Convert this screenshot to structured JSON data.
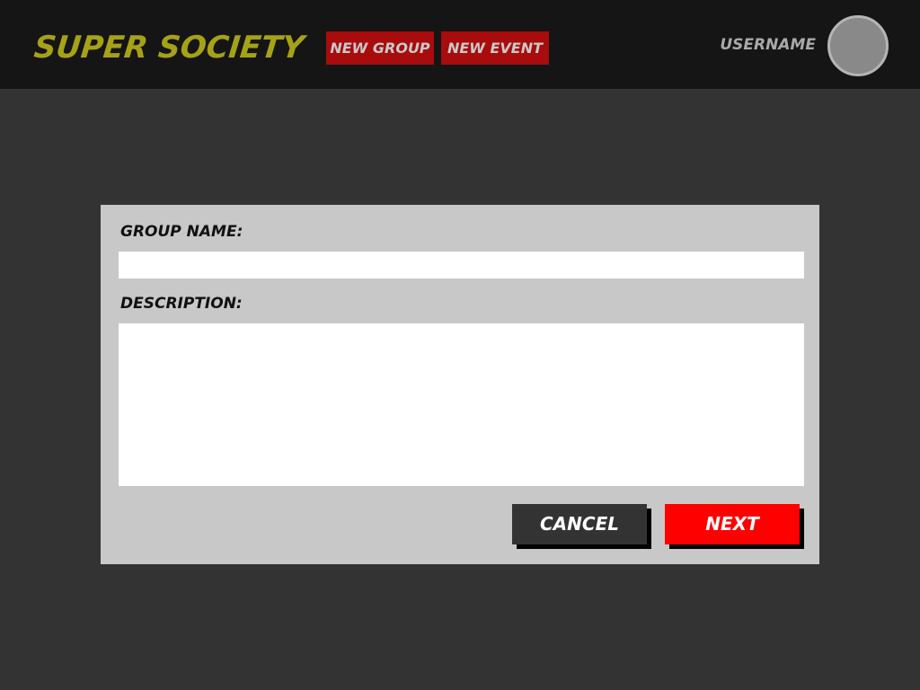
{
  "header": {
    "logo": "Super Society",
    "nav": {
      "new_group": "New Group",
      "new_event": "New Event"
    },
    "username": "Username",
    "avatar_icon": "user-avatar-icon"
  },
  "form": {
    "group_name_label": "Group Name:",
    "group_name_value": "",
    "group_name_placeholder": "",
    "description_label": "Description:",
    "description_value": "",
    "description_placeholder": "",
    "cancel_label": "Cancel",
    "next_label": "Next"
  },
  "colors": {
    "page_background": "#333333",
    "header_background": "#151515",
    "logo": "#a6a216",
    "nav_button": "#a80c0c",
    "dialog_background": "#c8c8c8",
    "cancel_button": "#333333",
    "next_button": "#ff0000"
  }
}
